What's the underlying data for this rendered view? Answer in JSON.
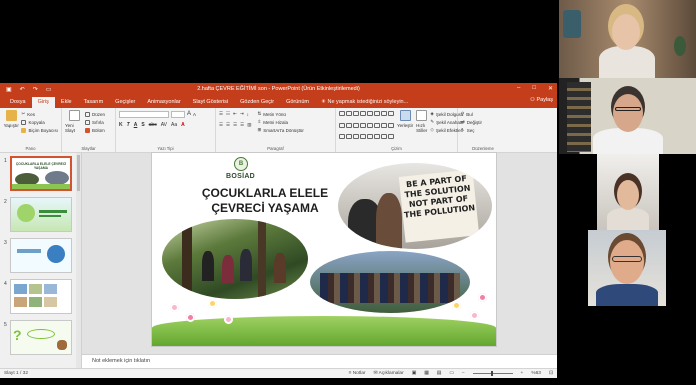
{
  "window": {
    "title": "2.hafta ÇEVRE EĞİTİMİ son - PowerPoint (Ürün Etkinleştirilemedi)",
    "minimize_glyph": "–",
    "maximize_glyph": "□",
    "close_glyph": "✕"
  },
  "tabs": [
    "Dosya",
    "Giriş",
    "Ekle",
    "Tasarım",
    "Geçişler",
    "Animasyonlar",
    "Slayt Gösterisi",
    "Gözden Geçir",
    "Görünüm"
  ],
  "active_tab": "Giriş",
  "tell_me": "Ne yapmak istediğinizi söyleyin...",
  "share": "Paylaş",
  "ribbon": {
    "clipboard": {
      "paste": "Yapıştır",
      "cut": "Kes",
      "copy": "Kopyala",
      "format_painter": "Biçim Boyacısı",
      "label": "Pano"
    },
    "slides": {
      "new_slide": "Yeni Slayt",
      "layout": "Düzen",
      "reset": "Sıfırla",
      "section": "Bölüm",
      "label": "Slaytlar"
    },
    "font": {
      "label": "Yazı Tipi",
      "bold": "K",
      "italic": "T",
      "underline": "A",
      "strike": "S",
      "shadow": "abc",
      "spacing": "AV",
      "case": "Aa",
      "grow": "A",
      "shrink": "A"
    },
    "paragraph": {
      "label": "Paragraf",
      "text_direction": "Metin Yönü",
      "align_text": "Metni Hizala",
      "smartart": "SmartArt'a Dönüştür"
    },
    "drawing": {
      "label": "Çizim",
      "arrange": "Yerleştir",
      "quick_styles": "Hızlı Stiller",
      "fill": "Şekil Dolgusu",
      "outline": "Şekil Anahattı",
      "effects": "Şekil Efektleri"
    },
    "editing": {
      "label": "Düzenleme",
      "find": "Bul",
      "replace": "Değiştir",
      "select": "Seç"
    }
  },
  "thumbnails": [
    {
      "num": "1",
      "title": "ÇOCUKLARLA ELELE ÇEVRECİ YAŞAMA"
    },
    {
      "num": "2",
      "title": ""
    },
    {
      "num": "3",
      "title": ""
    },
    {
      "num": "4",
      "title": ""
    },
    {
      "num": "5",
      "title": ""
    }
  ],
  "slide": {
    "logo_letter": "B",
    "brand": "BOSİAD",
    "title_line1": "ÇOCUKLARLA ELELE",
    "title_line2": "ÇEVRECİ YAŞAMA",
    "sign_text": "BE A PART OF THE SOLUTION NOT PART OF THE POLLUTION"
  },
  "notes_placeholder": "Not eklemek için tıklatın",
  "status": {
    "slide_count": "Slayt 1 / 32",
    "notes": "Notlar",
    "comments": "Açıklamalar",
    "zoom": "%63"
  },
  "colors": {
    "accent": "#c43e1c",
    "ribbon_bg": "#f3f3f3",
    "selected_thumb": "#d35230"
  }
}
